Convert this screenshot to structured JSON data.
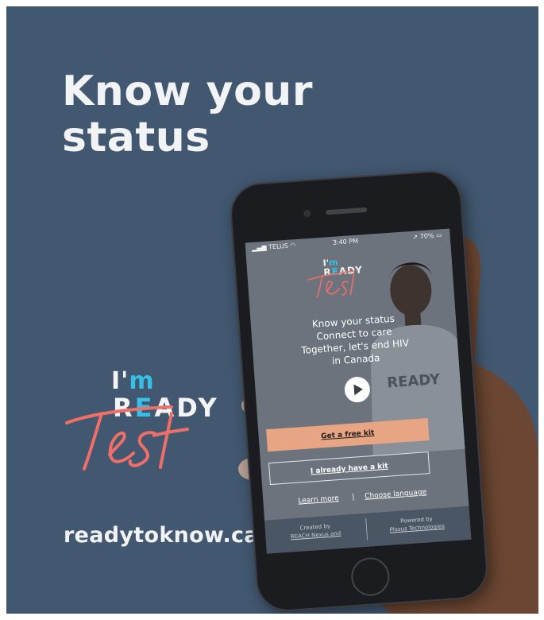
{
  "poster": {
    "headline_line1": "Know your",
    "headline_line2": "status",
    "url": "readytoknow.ca",
    "background_color": "#425870"
  },
  "logo": {
    "im": "I'",
    "m": "m",
    "ready_r": "R",
    "ready_e": "E",
    "ready_rest": "ADY",
    "accent_color": "#35c0e6",
    "script_color": "#ef6f68"
  },
  "phone": {
    "status_bar": {
      "carrier": "TELUS",
      "time": "3:40 PM",
      "battery": "70%"
    },
    "app": {
      "tagline": [
        "Know your status",
        "Connect to care",
        "Together, let's end HIV",
        "in Canada"
      ],
      "primary_button": "Get a free kit",
      "secondary_button": "I already have a kit",
      "learn_more": "Learn more",
      "separator": "|",
      "choose_language": "Choose language",
      "footer_left_label": "Created by",
      "footer_left_link": "REACH Nexus and",
      "footer_right_label": "Powered by",
      "footer_right_link": "Plazus Technologies",
      "shirt_text": "READY",
      "button_color": "#e8a584"
    }
  }
}
